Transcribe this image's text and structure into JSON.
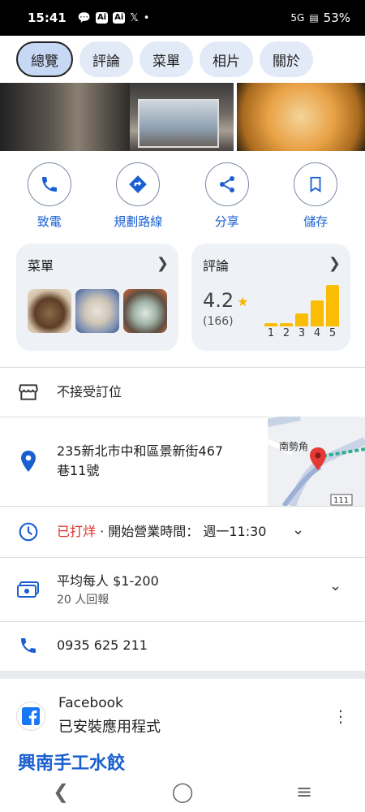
{
  "status_bar": {
    "time": "15:41",
    "icons": [
      "message-icon",
      "ai-icon",
      "ai-icon",
      "x-icon",
      "dot-icon"
    ],
    "ai_label": "Ai",
    "network": "5G",
    "battery": "53%"
  },
  "tabs": [
    {
      "label": "總覽",
      "active": true
    },
    {
      "label": "評論",
      "active": false
    },
    {
      "label": "菜單",
      "active": false
    },
    {
      "label": "相片",
      "active": false
    },
    {
      "label": "關於",
      "active": false
    }
  ],
  "actions": [
    {
      "label": "致電",
      "icon": "phone-icon"
    },
    {
      "label": "規劃路線",
      "icon": "directions-icon"
    },
    {
      "label": "分享",
      "icon": "share-icon"
    },
    {
      "label": "儲存",
      "icon": "bookmark-icon"
    }
  ],
  "menu_card": {
    "title": "菜單"
  },
  "reviews_card": {
    "title": "評論",
    "score": "4.2",
    "count": "(166)",
    "bar_labels": [
      "1",
      "2",
      "3",
      "4",
      "5"
    ],
    "bar_levels": [
      0.08,
      0.08,
      0.3,
      0.6,
      0.95
    ]
  },
  "info": {
    "reservation": "不接受訂位",
    "address_line1": "235新北市中和區景新街467",
    "address_line2": "巷11號",
    "hours_status": "已打烊",
    "hours_rest": " · 開始營業時間： 週一11:30",
    "price": "平均每人 $1-200",
    "price_reports": "20 人回報",
    "phone": "0935 625 211"
  },
  "map": {
    "label": "南勢角",
    "road": "111"
  },
  "app": {
    "name": "Facebook",
    "status": "已安裝應用程式"
  },
  "business_name": "興南手工水餃",
  "colors": {
    "accent": "#1a5fd0",
    "closed": "#d93025",
    "star": "#fbbc04"
  }
}
